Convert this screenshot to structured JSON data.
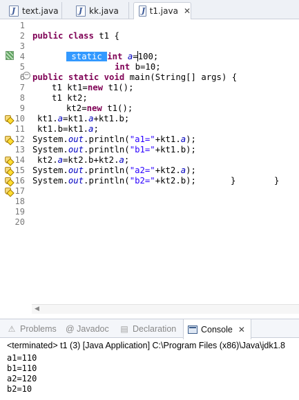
{
  "editor_tabs": [
    {
      "label": "text.java",
      "active": false,
      "closable": false
    },
    {
      "label": "kk.java",
      "active": false,
      "closable": false
    },
    {
      "label": "t1.java",
      "active": true,
      "closable": true,
      "close_glyph": "✕"
    }
  ],
  "code": {
    "line_numbers": [
      "1",
      "2",
      "3",
      "4",
      "5",
      "6",
      "7",
      "8",
      "9",
      "10",
      "11",
      "12",
      "13",
      "14",
      "15",
      "16",
      "17",
      "18",
      "19",
      "20"
    ],
    "keywords": {
      "public": "public",
      "class": "class",
      "static": "static",
      "int": "int",
      "void": "void",
      "new": "new"
    },
    "tokens": {
      "class_name": " t1 {",
      "a_decl": "a",
      "a_value": "=100;",
      "b_decl": " b=10;",
      "main_sig": " main(String[] args) {",
      "t1": "t1",
      "kt1_new": " kt1=",
      "t1_call": " t1();",
      "kt2_decl": " kt2;",
      "kt2_assign": "kt2=",
      "line10_a": "kt1.",
      "line10_b": "=kt1.",
      "line10_c": "+kt1.b;",
      "line11_a": "kt1.b=kt1.",
      "line11_b": ";",
      "sysout_a": "System.",
      "out": "out",
      "println": ".println(",
      "str_a1": "\"a1=\"",
      "str_b1": "\"b1=\"",
      "str_a2": "\"a2=\"",
      "str_b2": "\"b2=\"",
      "plus_kt1": "+kt1.",
      "plus_kt2": "+kt2.",
      "close_paren": ");",
      "kt1b_close": "+kt1.b);",
      "kt2b_close": "+kt2.b);",
      "line14_a": "kt2.",
      "line14_b": "=kt2.b+kt2.",
      "line14_c": ";",
      "brace1": "}",
      "brace2": "}"
    }
  },
  "views": [
    {
      "label": "Problems",
      "active": false,
      "icon": "problems-icon"
    },
    {
      "label": "@ Javadoc",
      "active": false,
      "icon": "javadoc-icon"
    },
    {
      "label": "Declaration",
      "active": false,
      "icon": "declaration-icon"
    },
    {
      "label": "Console",
      "active": true,
      "icon": "console-icon",
      "close_glyph": "✕"
    }
  ],
  "console": {
    "header": "<terminated> t1 (3) [Java Application] C:\\Program Files (x86)\\Java\\jdk1.8",
    "output": [
      "a1=110",
      "b1=110",
      "a2=120",
      "b2=10"
    ]
  }
}
